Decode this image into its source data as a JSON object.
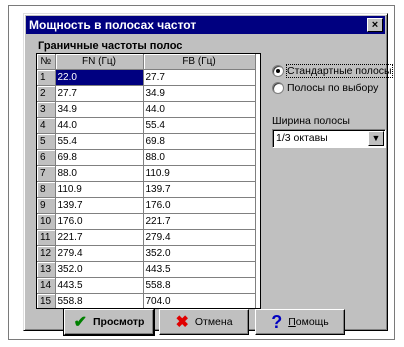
{
  "window": {
    "title": "Мощность в полосах частот",
    "close_glyph": "×"
  },
  "grid": {
    "group_label": "Граничные частоты полос",
    "columns": [
      "№",
      "FN (Гц)",
      "FB (Гц)"
    ],
    "rows": [
      [
        "1",
        "22.0",
        "27.7"
      ],
      [
        "2",
        "27.7",
        "34.9"
      ],
      [
        "3",
        "34.9",
        "44.0"
      ],
      [
        "4",
        "44.0",
        "55.4"
      ],
      [
        "5",
        "55.4",
        "69.8"
      ],
      [
        "6",
        "69.8",
        "88.0"
      ],
      [
        "7",
        "88.0",
        "110.9"
      ],
      [
        "8",
        "110.9",
        "139.7"
      ],
      [
        "9",
        "139.7",
        "176.0"
      ],
      [
        "10",
        "176.0",
        "221.7"
      ],
      [
        "11",
        "221.7",
        "279.4"
      ],
      [
        "12",
        "279.4",
        "352.0"
      ],
      [
        "13",
        "352.0",
        "443.5"
      ],
      [
        "14",
        "443.5",
        "558.8"
      ],
      [
        "15",
        "558.8",
        "704.0"
      ]
    ]
  },
  "options": {
    "standard_bands": "Стандартные полосы",
    "custom_bands": "Полосы по выбору",
    "selected": "standard"
  },
  "bandwidth": {
    "label": "Ширина полосы",
    "value": "1/3 октавы"
  },
  "buttons": {
    "view": "Просмотр",
    "cancel": "Отмена",
    "help_first": "П",
    "help_rest": "омощь"
  },
  "icons": {
    "view": "checkmark-icon",
    "cancel": "x-icon",
    "help": "question-icon"
  },
  "colors": {
    "title_bar": "#000080",
    "face": "#c0c0c0",
    "check": "#008000",
    "cancel": "#e00000",
    "help": "#0000c0"
  }
}
